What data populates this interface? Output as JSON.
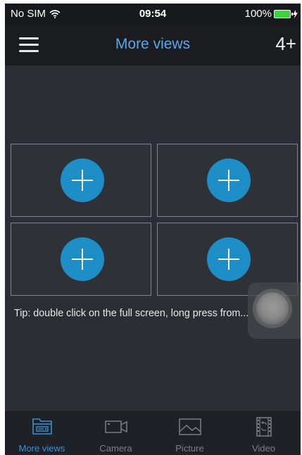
{
  "status_bar": {
    "carrier": "No SIM",
    "time": "09:54",
    "battery": "100%"
  },
  "nav": {
    "title": "More views",
    "count": "4+"
  },
  "grid": {
    "cells": [
      {
        "label": "add"
      },
      {
        "label": "add"
      },
      {
        "label": "add"
      },
      {
        "label": "add"
      }
    ]
  },
  "tip": "Tip: double click on the full screen, long press from...",
  "tabs": [
    {
      "label": "More views",
      "icon": "nvr-icon",
      "active": true
    },
    {
      "label": "Camera",
      "icon": "camera-icon",
      "active": false
    },
    {
      "label": "Picture",
      "icon": "picture-icon",
      "active": false
    },
    {
      "label": "Video",
      "icon": "video-icon",
      "active": false
    }
  ],
  "colors": {
    "accent": "#3a8fd6",
    "add_button": "#1e8ec7",
    "background": "#2b2f35"
  }
}
